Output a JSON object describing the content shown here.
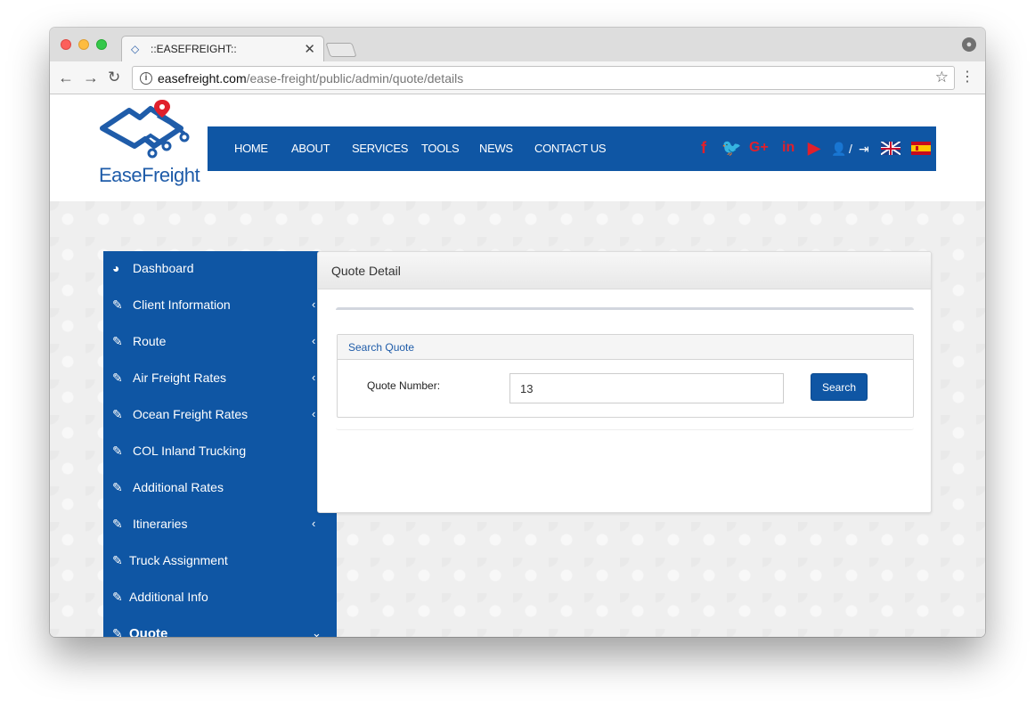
{
  "browser": {
    "tab_title": "::EASEFREIGHT::",
    "tab_close": "✕",
    "url_host": "easefreight.com",
    "url_path": "/ease-freight/public/admin/quote/details"
  },
  "site": {
    "logo_text": "EaseFreight",
    "nav": [
      "HOME",
      "ABOUT",
      "SERVICES",
      "TOOLS",
      "NEWS",
      "CONTACT US"
    ],
    "social_icons": [
      "facebook-icon",
      "twitter-icon",
      "google-plus-icon",
      "linkedin-icon",
      "youtube-icon"
    ],
    "user_separator": "/",
    "languages": [
      "uk-flag",
      "spain-flag"
    ],
    "colors": {
      "brand_blue": "#0f56a4",
      "social_red": "#e0202c"
    }
  },
  "sidebar": {
    "items": [
      {
        "label": "Dashboard",
        "icon": "dashboard-icon",
        "chevron": ""
      },
      {
        "label": "Client Information",
        "icon": "edit-icon",
        "chevron": "‹"
      },
      {
        "label": "Route",
        "icon": "edit-icon",
        "chevron": "‹"
      },
      {
        "label": "Air Freight Rates",
        "icon": "edit-icon",
        "chevron": "‹"
      },
      {
        "label": "Ocean Freight Rates",
        "icon": "edit-icon",
        "chevron": "‹"
      },
      {
        "label": "COL Inland Trucking",
        "icon": "edit-icon",
        "chevron": ""
      },
      {
        "label": "Additional Rates",
        "icon": "edit-icon",
        "chevron": ""
      },
      {
        "label": "Itineraries",
        "icon": "edit-icon",
        "chevron": "‹"
      },
      {
        "label": "Truck Assignment",
        "icon": "edit-icon",
        "chevron": ""
      },
      {
        "label": "Additional Info",
        "icon": "edit-icon",
        "chevron": ""
      },
      {
        "label": "Quote",
        "icon": "edit-icon",
        "chevron": "⌄"
      }
    ]
  },
  "panel": {
    "title": "Quote Detail",
    "search_box_title": "Search Quote",
    "field_label": "Quote Number:",
    "field_value": "13",
    "search_button": "Search"
  }
}
